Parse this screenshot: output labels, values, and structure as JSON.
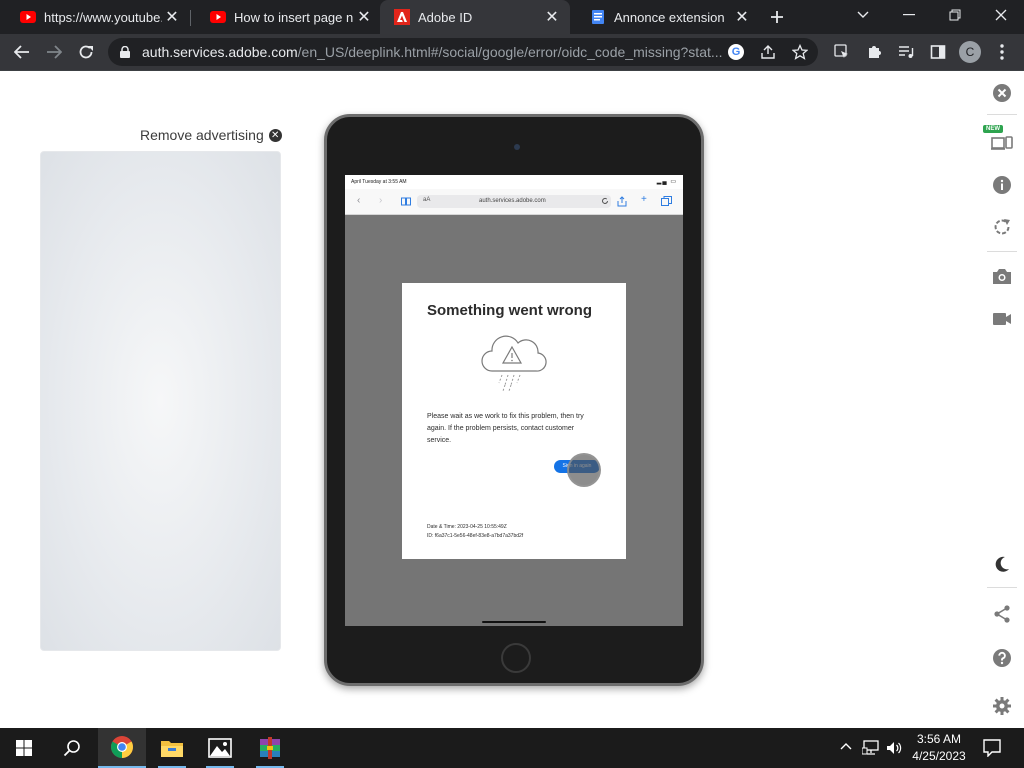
{
  "browser": {
    "tabs": [
      {
        "title": "https://www.youtube.co",
        "icon": "youtube-icon"
      },
      {
        "title": "How to insert page num",
        "icon": "youtube-icon"
      },
      {
        "title": "Adobe ID",
        "icon": "adobe-icon"
      },
      {
        "title": "Annonce extension",
        "icon": "document-icon"
      }
    ],
    "address": {
      "host": "auth.services.adobe.com",
      "path": "/en_US/deeplink.html#/social/google/error/oidc_code_missing?stat..."
    },
    "profile_initial": "C"
  },
  "page": {
    "remove_ad_label": "Remove advertising",
    "ipad": {
      "status_time": "April Tuesday at 3:55 AM",
      "safari_aa": "aA",
      "safari_url": "auth.services.adobe.com",
      "card": {
        "title": "Something went wrong",
        "message": "Please wait as we work to fix this problem, then try again. If the problem persists, contact customer service.",
        "button": "Sign in again",
        "date_line": "Date & Time: 2023-04-25 10:55:49Z",
        "id_line": "ID: f6a37c1-5e56-48ef-83e8-a7bd7a37bd2f"
      }
    },
    "rail": {
      "new_badge": "NEW"
    }
  },
  "taskbar": {
    "time": "3:56 AM",
    "date": "4/25/2023"
  },
  "colors": {
    "chrome_dark": "#202124",
    "chrome_toolbar": "#35363a",
    "adobe_red": "#e1251b",
    "youtube_red": "#ff0000",
    "adobe_blue": "#1473e6",
    "taskbar": "#1b1b1b"
  }
}
